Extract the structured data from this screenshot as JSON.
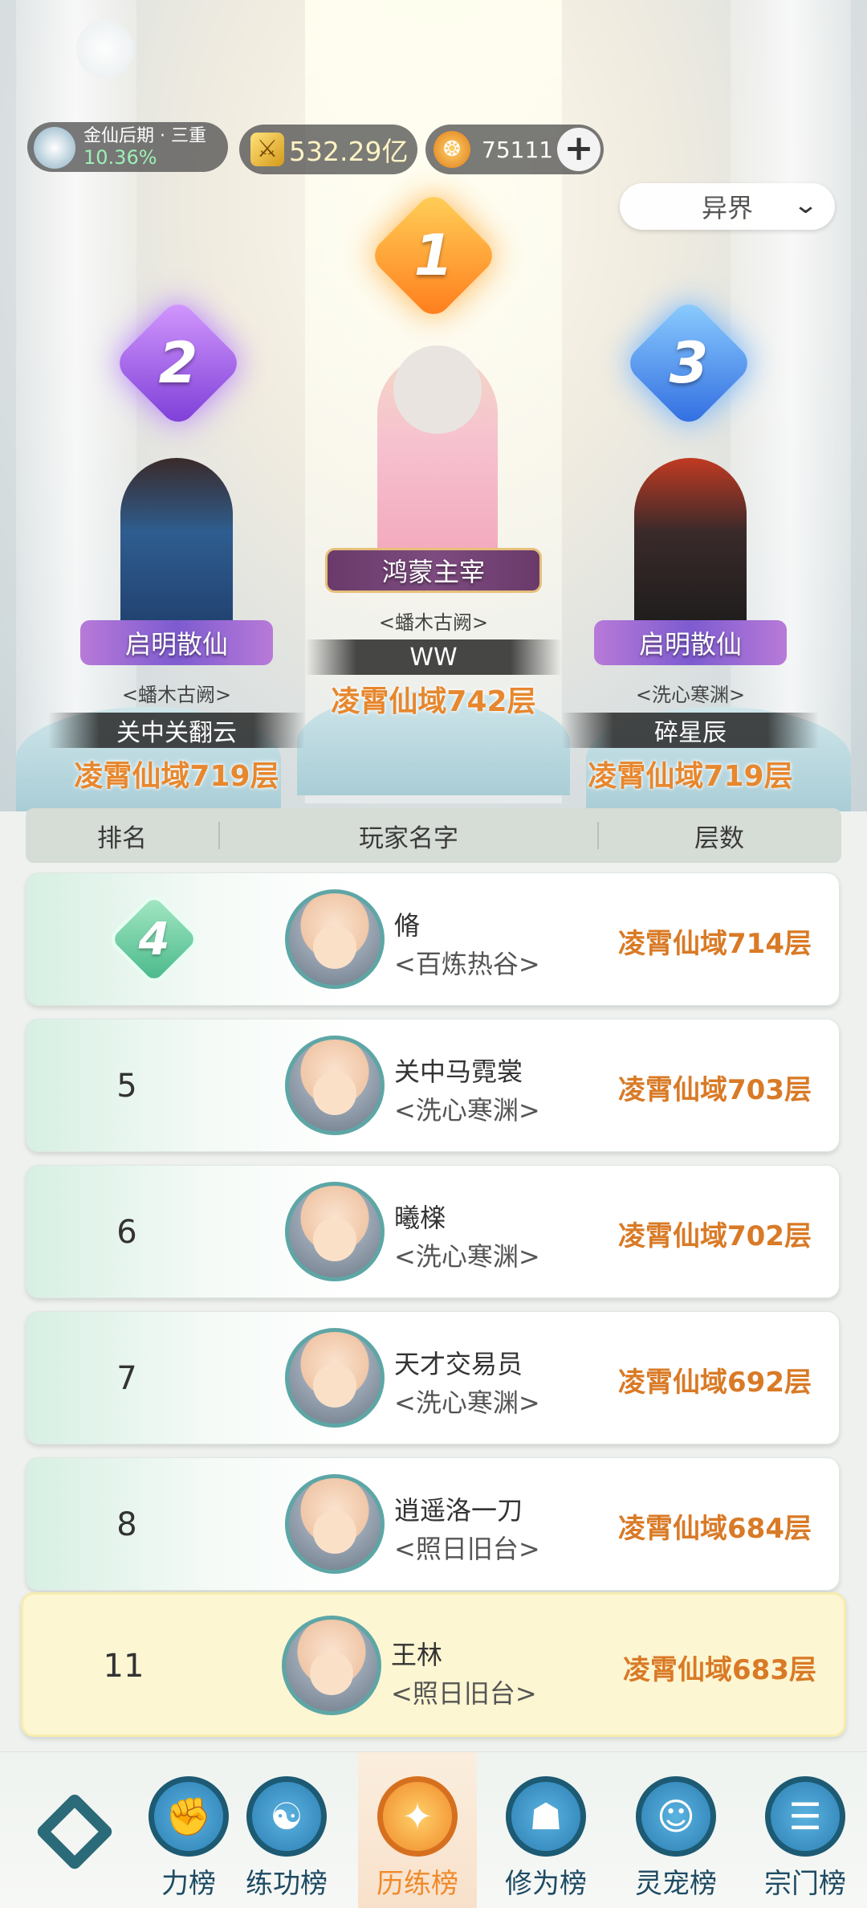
{
  "status": {
    "realm": "金仙后期 · 三重",
    "realm_progress": "10.36%",
    "gold": "532.29亿",
    "jade": "75111"
  },
  "icons": {
    "realm": "immortal-avatar-icon",
    "gold": "sword-currency-icon",
    "jade": "peach-currency-icon",
    "add": "plus-icon",
    "dropdown": "chevron-down-icon"
  },
  "filter": {
    "selected": "异界"
  },
  "podium": [
    {
      "rank": "1",
      "title": "鸿蒙主宰",
      "guild": "<蟠木古阙>",
      "name": "WW",
      "floor": "凌霄仙域742层"
    },
    {
      "rank": "2",
      "title": "启明散仙",
      "guild": "<蟠木古阙>",
      "name": "关中关翻云",
      "floor": "凌霄仙域719层"
    },
    {
      "rank": "3",
      "title": "启明散仙",
      "guild": "<洗心寒渊>",
      "name": "碎星辰",
      "floor": "凌霄仙域719层"
    }
  ],
  "table": {
    "headers": {
      "rank": "排名",
      "player": "玩家名字",
      "floor": "层数"
    },
    "rows": [
      {
        "rank": "4",
        "name": "脩",
        "guild": "<百炼热谷>",
        "floor": "凌霄仙域714层"
      },
      {
        "rank": "5",
        "name": "关中马霓裳",
        "guild": "<洗心寒渊>",
        "floor": "凌霄仙域703层"
      },
      {
        "rank": "6",
        "name": "曦檪",
        "guild": "<洗心寒渊>",
        "floor": "凌霄仙域702层"
      },
      {
        "rank": "7",
        "name": "天才交易员",
        "guild": "<洗心寒渊>",
        "floor": "凌霄仙域692层"
      },
      {
        "rank": "8",
        "name": "逍遥洛一刀",
        "guild": "<照日旧台>",
        "floor": "凌霄仙域684层"
      }
    ],
    "self_row": {
      "rank": "11",
      "name": "王林",
      "guild": "<照日旧台>",
      "floor": "凌霄仙域683层"
    }
  },
  "nav": {
    "items": [
      {
        "label": "力榜",
        "icon": "fist-icon"
      },
      {
        "label": "练功榜",
        "icon": "yin-yang-icon"
      },
      {
        "label": "历练榜",
        "icon": "star-burst-icon",
        "active": true
      },
      {
        "label": "修为榜",
        "icon": "meditation-hat-icon"
      },
      {
        "label": "灵宠榜",
        "icon": "spirit-pet-icon"
      },
      {
        "label": "宗门榜",
        "icon": "scroll-icon"
      }
    ]
  },
  "colors": {
    "accent_orange": "#f08a2a",
    "floor_text": "#d97a26",
    "nav_blue": "#1e4b63",
    "realm_pct": "#9ef0b5"
  }
}
